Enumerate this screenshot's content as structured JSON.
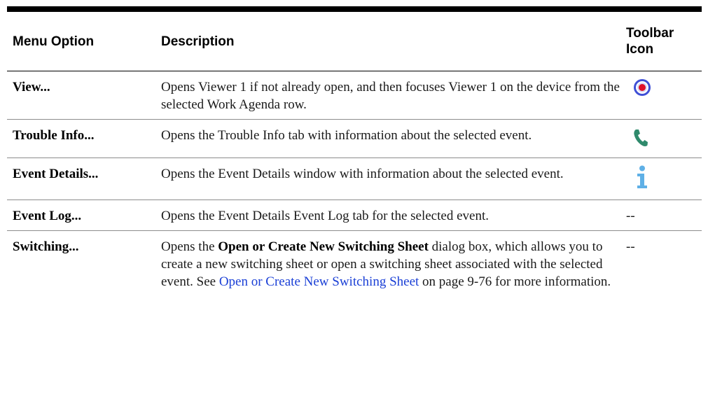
{
  "table": {
    "headers": {
      "menu_option": "Menu Option",
      "description": "Description",
      "toolbar_icon_line1": "Toolbar",
      "toolbar_icon_line2": "Icon"
    },
    "rows": [
      {
        "option": "View...",
        "description": "Opens Viewer 1 if not already open, and then focuses Viewer 1 on the device from the selected Work Agenda row.",
        "icon": "target-icon"
      },
      {
        "option": "Trouble Info...",
        "description": "Opens the Trouble Info tab with information about the selected event.",
        "icon": "phone-icon"
      },
      {
        "option": "Event Details...",
        "description": "Opens the Event Details window with information about the selected event.",
        "icon": "info-icon"
      },
      {
        "option": "Event Log...",
        "description": "Opens the Event Details Event Log tab for the selected event.",
        "icon_text": "--"
      },
      {
        "option": "Switching...",
        "description_part1": "Opens the ",
        "description_bold": "Open or Create New Switching Sheet",
        "description_part2": " dialog box, which allows you to create a new switching sheet or open a switching sheet associated with the selected event. See ",
        "description_link": "Open or Create New Switching Sheet",
        "description_part3": " on page 9-76 for more information.",
        "icon_text": "--"
      }
    ]
  },
  "colors": {
    "target_outer": "#3f4fd6",
    "target_inner": "#e0102a",
    "phone": "#2f8a6c",
    "info": "#5fb0e6",
    "link": "#1a3fd6"
  }
}
